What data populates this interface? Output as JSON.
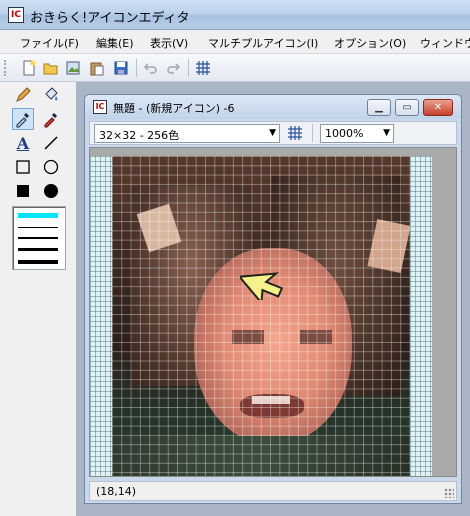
{
  "app": {
    "title": "おきらく!アイコンエディタ",
    "icon_label": "IC"
  },
  "menu": [
    "ファイル(F)",
    "編集(E)",
    "表示(V)",
    "マルチプルアイコン(I)",
    "オプション(O)",
    "ウィンドウ("
  ],
  "toolbar": {
    "buttons": [
      "new-icon",
      "open-folder-icon",
      "import-image-icon",
      "paste-icon",
      "save-icon",
      "undo-icon",
      "redo-icon",
      "grid-icon"
    ]
  },
  "tools": {
    "items": [
      "pencil-icon",
      "fill-bucket-icon",
      "eyedropper-icon",
      "color-picker-icon",
      "text-icon",
      "line-icon",
      "rectangle-icon",
      "ellipse-icon",
      "filled-rectangle-icon",
      "filled-ellipse-icon"
    ],
    "active": "eyedropper-icon",
    "text_tool_label": "A",
    "line_widths_selected_index": 0
  },
  "document": {
    "title": "無題 - (新規アイコン) -6",
    "format_select": "32×32 - 256色",
    "zoom_select": "1000%",
    "status_coords": "(18,14)"
  },
  "colors": {
    "title_gradient": "#bcd2ec",
    "selected_line": "#00e5ff",
    "cursor_fill": "#f6f28a",
    "close_button": "#c7402b"
  }
}
